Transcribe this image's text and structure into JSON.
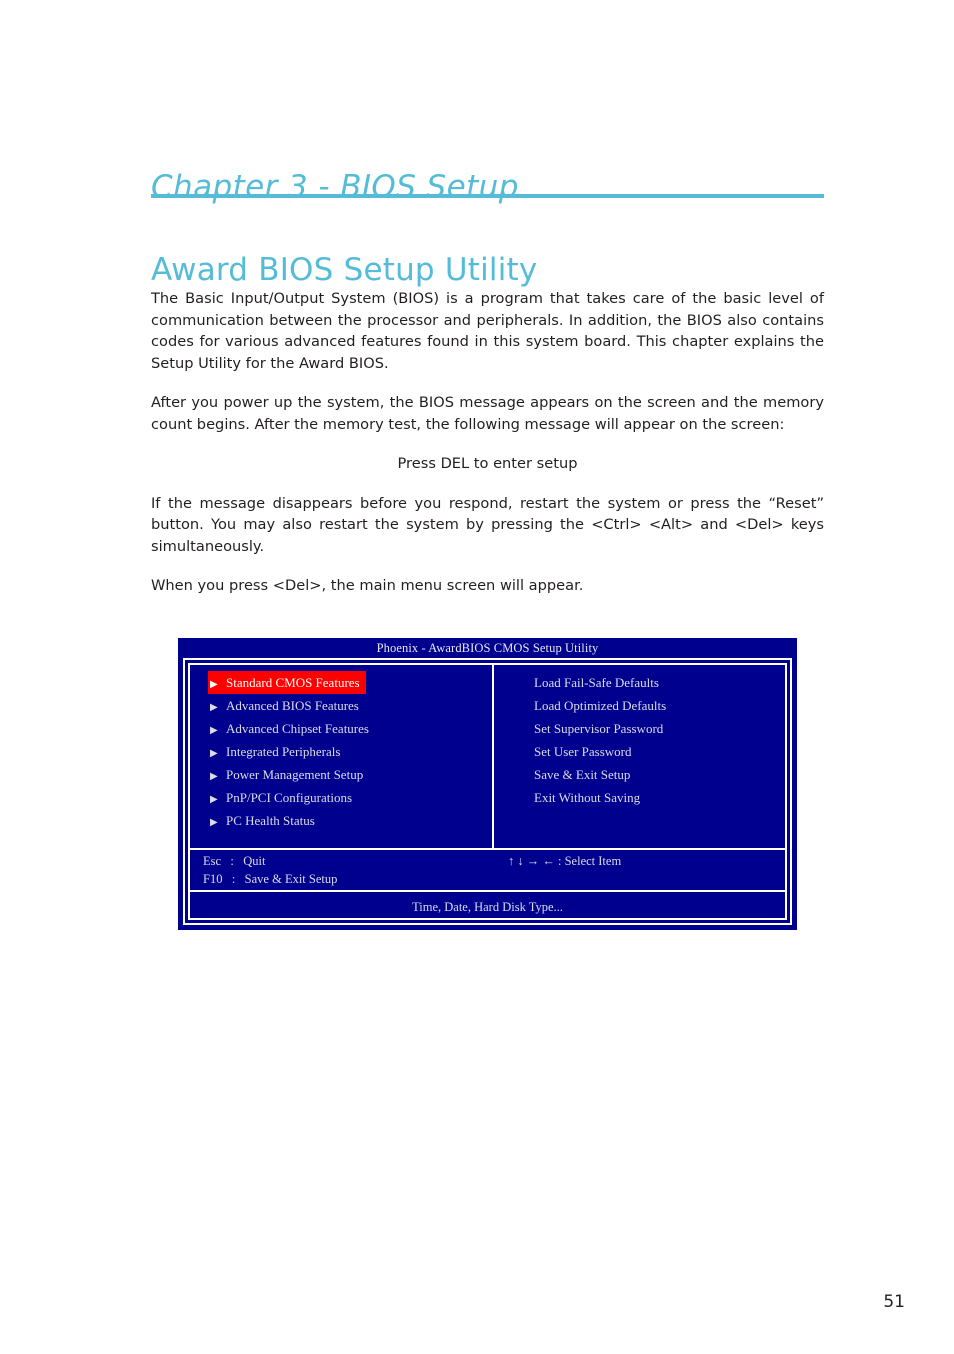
{
  "document": {
    "chapter_title": "Chapter 3 - BIOS Setup",
    "section_title": "Award BIOS Setup Utility",
    "accent_color": "#55bcd8",
    "page_number": "51"
  },
  "body": {
    "paragraph_1": "The Basic Input/Output System (BIOS) is a program that takes care of the basic level of communication between the processor and peripherals. In addition, the BIOS also contains codes for various advanced features found in this system board. This chapter explains the Setup Utility for the Award BIOS.",
    "paragraph_2": "After you power up the system, the BIOS message appears on the screen and the memory count begins. After the memory test, the following message will appear on the screen:",
    "centered_message": "Press DEL to enter setup",
    "paragraph_3": "If the message disappears before you respond, restart the system or press the “Reset” button. You may also restart the system by pressing the <Ctrl> <Alt> and <Del> keys simultaneously.",
    "paragraph_4": "When you press <Del>, the main menu screen will appear."
  },
  "bios_screen": {
    "title": "Phoenix - AwardBIOS CMOS Setup Utility",
    "background_color": "#00008f",
    "highlight_color": "#ff0000",
    "text_color": "#dcdce8",
    "bullet_glyph": "▶",
    "left_menu": [
      {
        "label": "Standard CMOS Features",
        "selected": true
      },
      {
        "label": "Advanced BIOS Features",
        "selected": false
      },
      {
        "label": "Advanced Chipset Features",
        "selected": false
      },
      {
        "label": "Integrated Peripherals",
        "selected": false
      },
      {
        "label": "Power Management Setup",
        "selected": false
      },
      {
        "label": "PnP/PCI Configurations",
        "selected": false
      },
      {
        "label": "PC Health Status",
        "selected": false
      }
    ],
    "right_menu": [
      {
        "label": "Load Fail-Safe Defaults"
      },
      {
        "label": "Load Optimized Defaults"
      },
      {
        "label": "Set Supervisor Password"
      },
      {
        "label": "Set User Password"
      },
      {
        "label": "Save & Exit Setup"
      },
      {
        "label": "Exit Without Saving"
      }
    ],
    "key_legend_left": "Esc   :   Quit\nF10   :   Save & Exit Setup",
    "key_legend_right": "↑ ↓ → ← : Select Item",
    "status_text": "Time, Date, Hard Disk Type..."
  }
}
